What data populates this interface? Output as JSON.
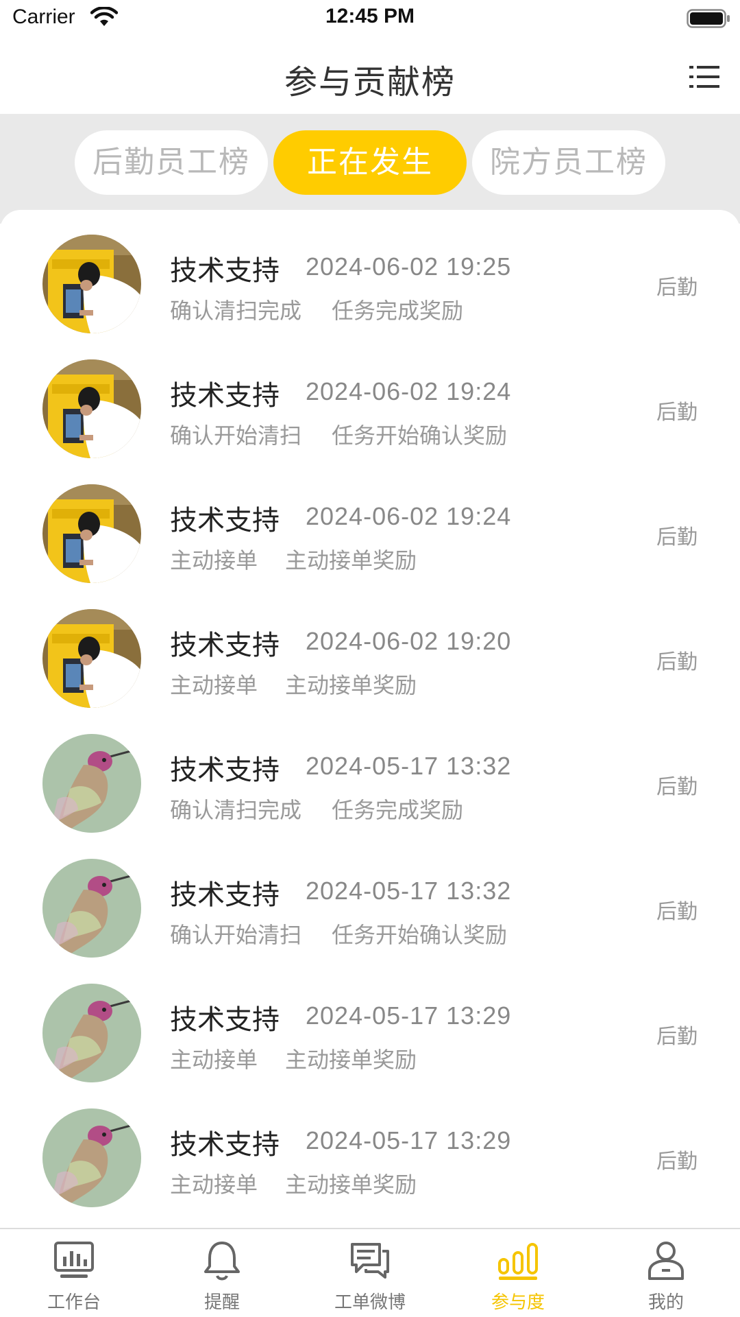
{
  "status_bar": {
    "carrier": "Carrier",
    "time": "12:45 PM"
  },
  "header": {
    "title": "参与贡献榜",
    "menu_icon": "list-menu-icon"
  },
  "tabs": [
    {
      "label": "后勤员工榜",
      "active": false
    },
    {
      "label": "正在发生",
      "active": true
    },
    {
      "label": "院方员工榜",
      "active": false
    }
  ],
  "colors": {
    "accent": "#ffcc00",
    "tab_bg": "#e9e9e9",
    "text_gray": "#999999"
  },
  "feed": [
    {
      "name": "技术支持",
      "time": "2024-06-02 19:25",
      "action": "确认清扫完成",
      "reward": "任务完成奖励",
      "dept": "后勤",
      "avatar": "photo-worker"
    },
    {
      "name": "技术支持",
      "time": "2024-06-02 19:24",
      "action": "确认开始清扫",
      "reward": "任务开始确认奖励",
      "dept": "后勤",
      "avatar": "photo-worker"
    },
    {
      "name": "技术支持",
      "time": "2024-06-02 19:24",
      "action": "主动接单",
      "reward": "主动接单奖励",
      "dept": "后勤",
      "avatar": "photo-worker"
    },
    {
      "name": "技术支持",
      "time": "2024-06-02 19:20",
      "action": "主动接单",
      "reward": "主动接单奖励",
      "dept": "后勤",
      "avatar": "photo-worker"
    },
    {
      "name": "技术支持",
      "time": "2024-05-17 13:32",
      "action": "确认清扫完成",
      "reward": "任务完成奖励",
      "dept": "后勤",
      "avatar": "photo-hummingbird"
    },
    {
      "name": "技术支持",
      "time": "2024-05-17 13:32",
      "action": "确认开始清扫",
      "reward": "任务开始确认奖励",
      "dept": "后勤",
      "avatar": "photo-hummingbird"
    },
    {
      "name": "技术支持",
      "time": "2024-05-17 13:29",
      "action": "主动接单",
      "reward": "主动接单奖励",
      "dept": "后勤",
      "avatar": "photo-hummingbird"
    },
    {
      "name": "技术支持",
      "time": "2024-05-17 13:29",
      "action": "主动接单",
      "reward": "主动接单奖励",
      "dept": "后勤",
      "avatar": "photo-hummingbird"
    }
  ],
  "tab_bar": [
    {
      "label": "工作台",
      "icon": "dashboard-icon",
      "active": false
    },
    {
      "label": "提醒",
      "icon": "bell-icon",
      "active": false
    },
    {
      "label": "工单微博",
      "icon": "chat-bubbles-icon",
      "active": false
    },
    {
      "label": "参与度",
      "icon": "participation-bars-icon",
      "active": true
    },
    {
      "label": "我的",
      "icon": "user-icon",
      "active": false
    }
  ]
}
